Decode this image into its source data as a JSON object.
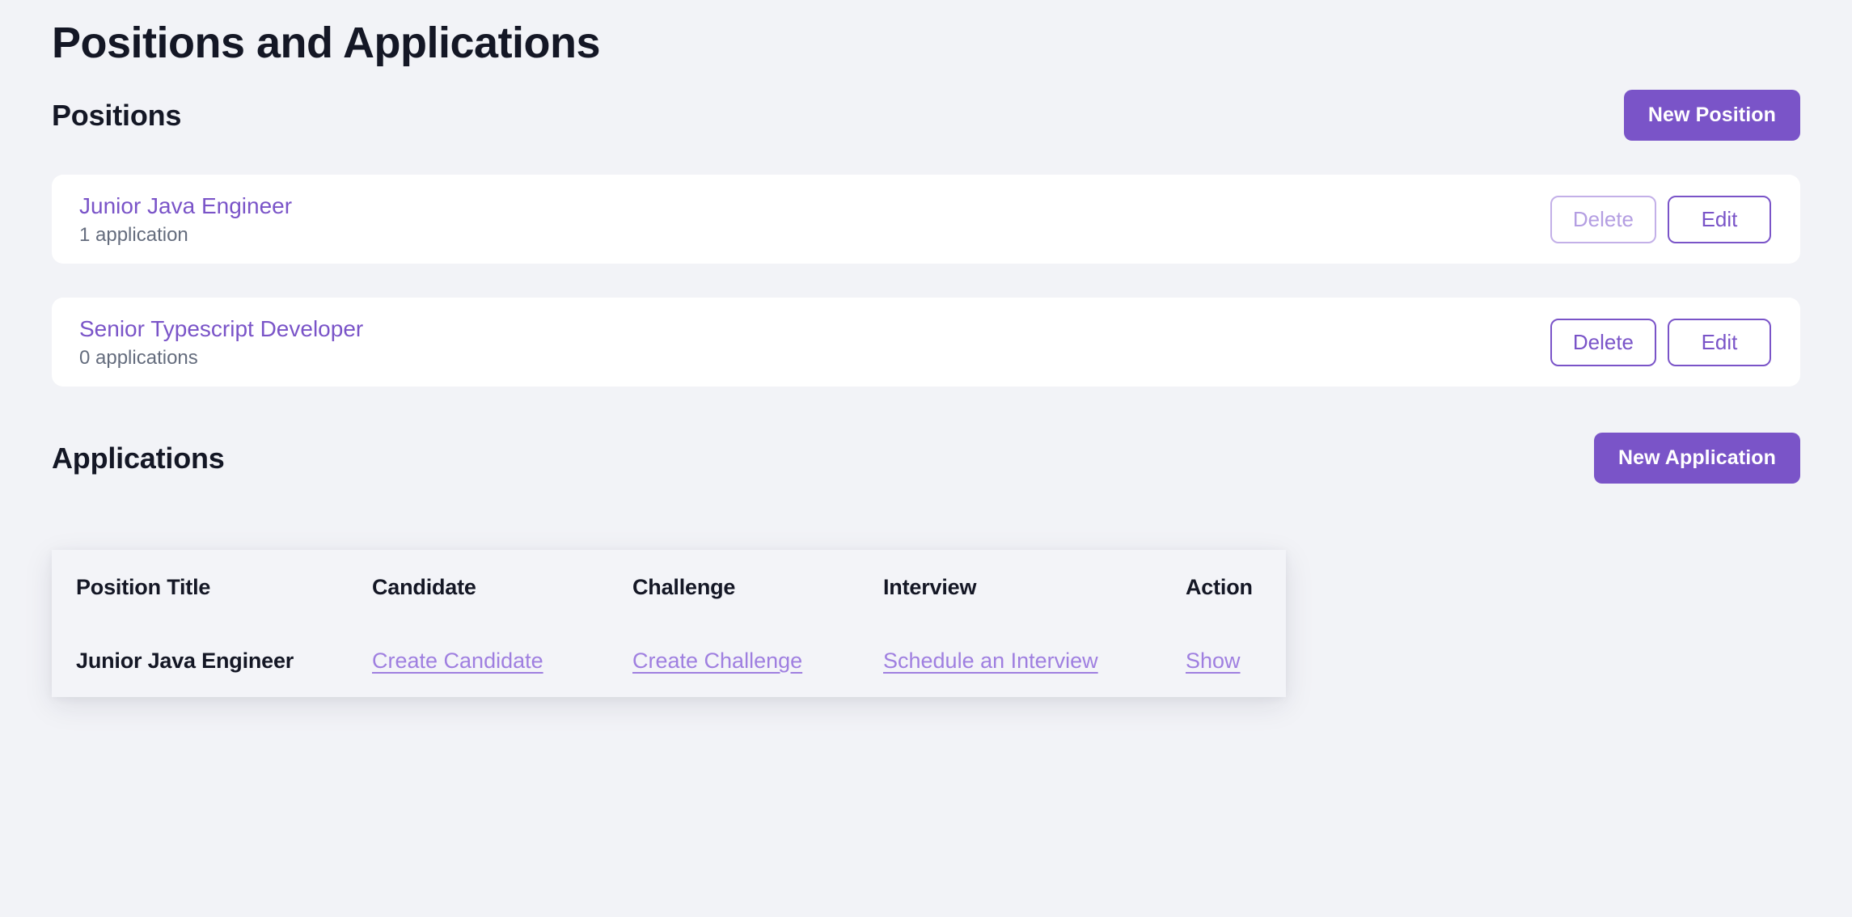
{
  "page": {
    "title": "Positions and Applications",
    "background_color": "#f2f3f7",
    "accent_color": "#7a54c8",
    "link_color": "#9f7fe0",
    "text_color": "#141725",
    "muted_text_color": "#646c7d"
  },
  "positions_section": {
    "title": "Positions",
    "new_button_label": "New Position",
    "items": [
      {
        "name": "Junior Java Engineer",
        "applications_text": "1 application",
        "delete_label": "Delete",
        "delete_state": "disabled",
        "edit_label": "Edit"
      },
      {
        "name": "Senior Typescript Developer",
        "applications_text": "0 applications",
        "delete_label": "Delete",
        "delete_state": "enabled",
        "edit_label": "Edit"
      }
    ]
  },
  "applications_section": {
    "title": "Applications",
    "new_button_label": "New Application",
    "table": {
      "columns": [
        "Position Title",
        "Candidate",
        "Challenge",
        "Interview",
        "Action"
      ],
      "rows": [
        {
          "position_title": "Junior Java Engineer",
          "candidate": "Create Candidate",
          "challenge": "Create Challenge",
          "interview": "Schedule an Interview",
          "action": "Show"
        }
      ]
    }
  }
}
